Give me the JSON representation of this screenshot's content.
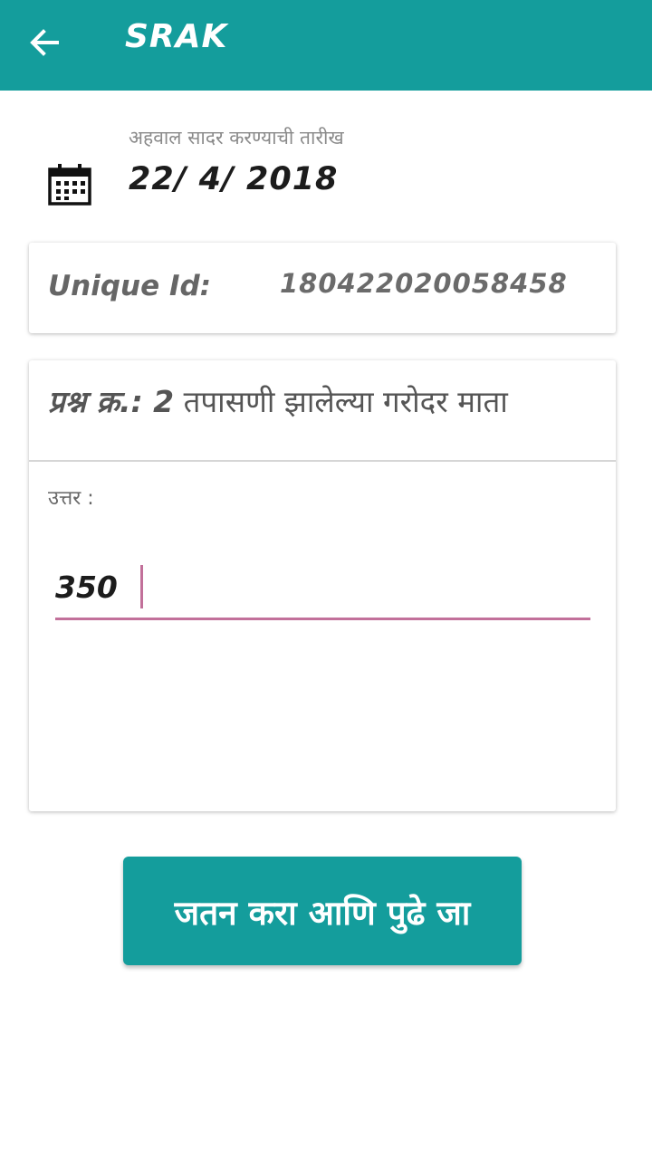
{
  "app_bar": {
    "title": "SRAK",
    "back_icon": "arrow-left-icon",
    "background_color": "#149d9c"
  },
  "report_date": {
    "label": "अहवाल सादर करण्याची तारीख",
    "value": "22/ 4/ 2018",
    "icon": "calendar-icon"
  },
  "unique_id": {
    "label": "Unique Id:",
    "value": "180422020058458"
  },
  "question": {
    "prefix": "प्रश्न क्र.: 2",
    "text": "तपासणी झालेल्या गरोदर माता"
  },
  "answer": {
    "label": "उत्तर :",
    "value": "350",
    "underline_color": "#c2709a"
  },
  "save_button": {
    "label": "जतन करा आणि पुढे जा"
  }
}
